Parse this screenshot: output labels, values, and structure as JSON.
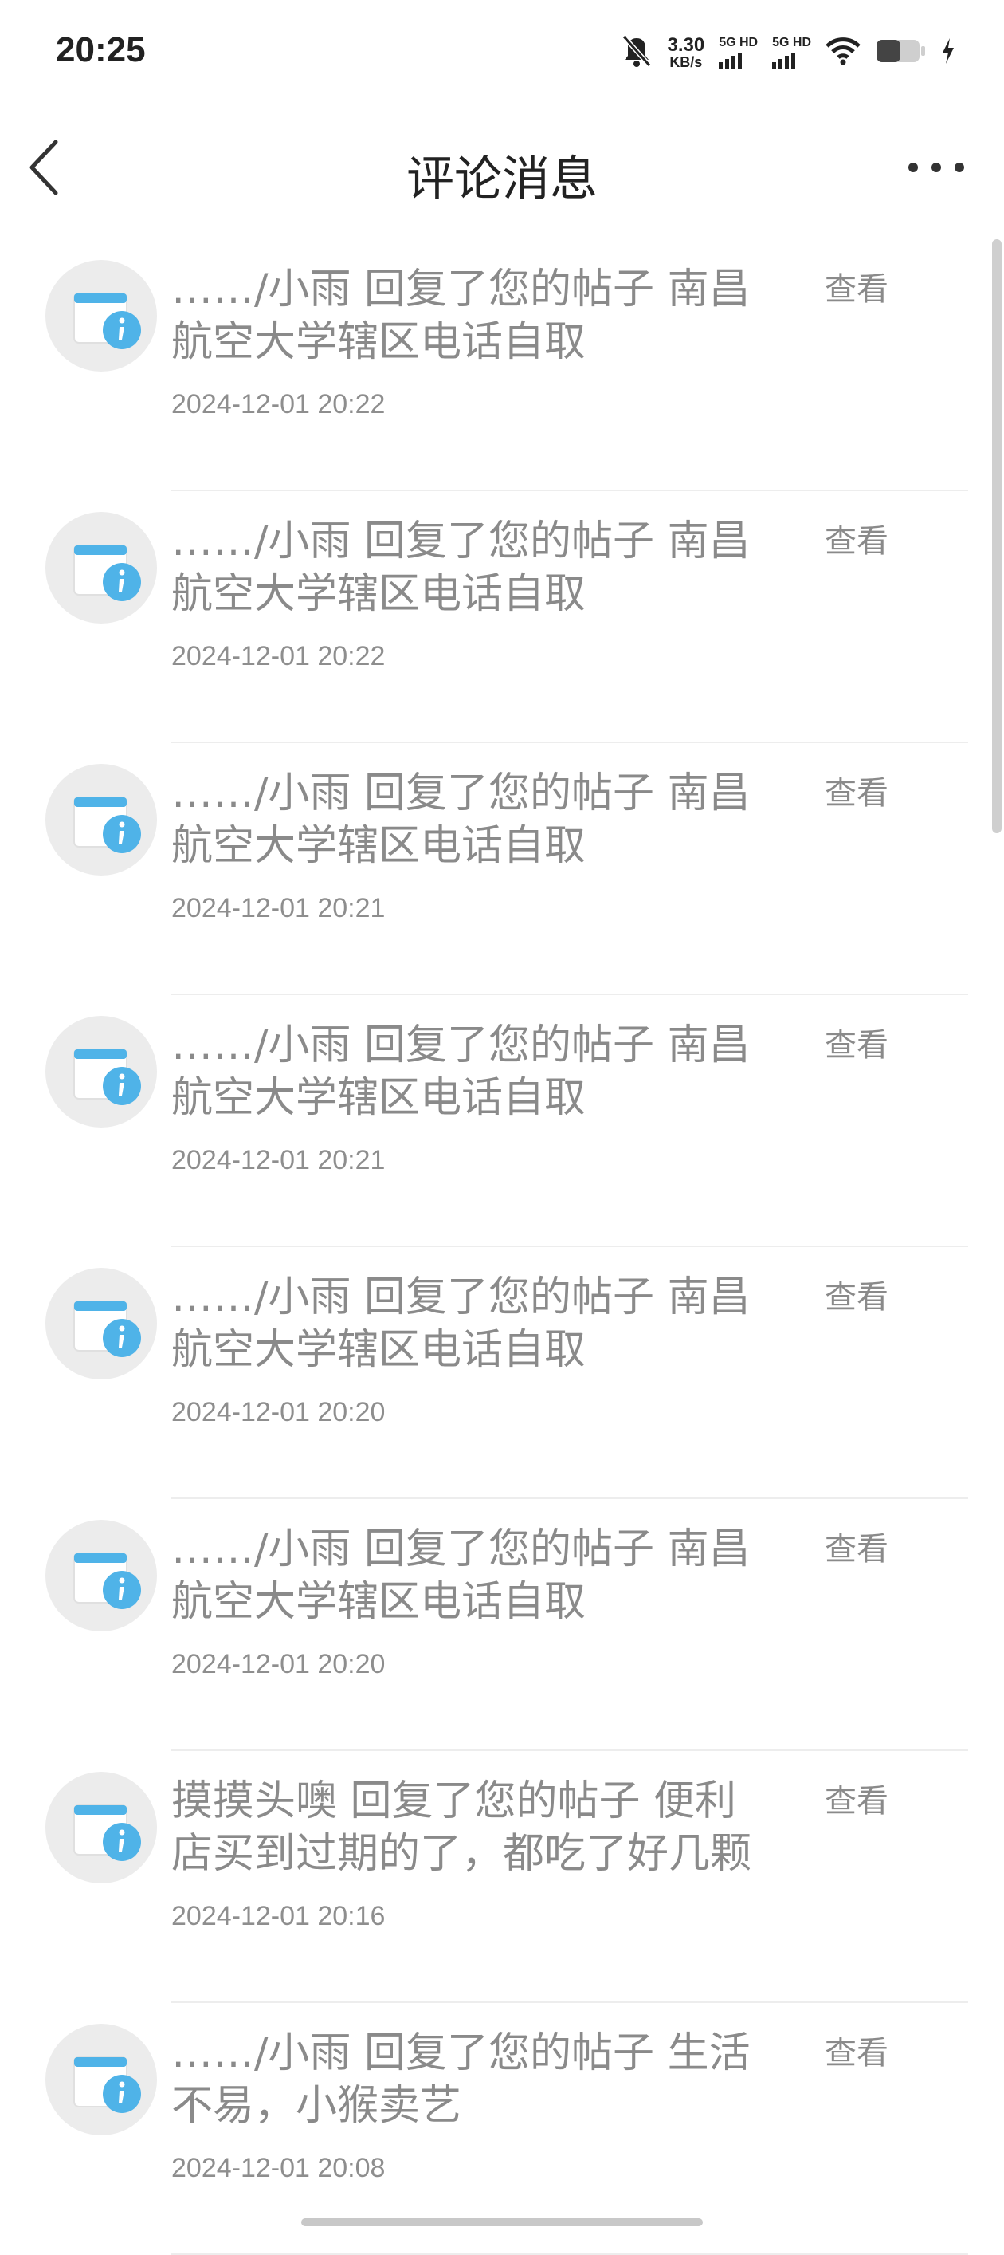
{
  "status_bar": {
    "time": "20:25",
    "net_speed_value": "3.30",
    "net_speed_unit": "KB/s",
    "sim1_label": "5G HD",
    "sim2_label": "5G HD",
    "icons": [
      "bell-muted-icon",
      "signal-icon",
      "wifi-icon",
      "battery-icon",
      "charging-icon"
    ]
  },
  "header": {
    "title": "评论消息",
    "back_icon": "chevron-left-icon",
    "more_icon": "more-icon"
  },
  "notifications": [
    {
      "message_line1": "……/小雨 回复了您的帖子 南昌",
      "message_line2": "航空大学辖区电话自取",
      "date": "2024-12-01 20:22",
      "action": "查看"
    },
    {
      "message_line1": "……/小雨 回复了您的帖子 南昌",
      "message_line2": "航空大学辖区电话自取",
      "date": "2024-12-01 20:22",
      "action": "查看"
    },
    {
      "message_line1": "……/小雨 回复了您的帖子 南昌",
      "message_line2": "航空大学辖区电话自取",
      "date": "2024-12-01 20:21",
      "action": "查看"
    },
    {
      "message_line1": "……/小雨 回复了您的帖子 南昌",
      "message_line2": "航空大学辖区电话自取",
      "date": "2024-12-01 20:21",
      "action": "查看"
    },
    {
      "message_line1": "……/小雨 回复了您的帖子 南昌",
      "message_line2": "航空大学辖区电话自取",
      "date": "2024-12-01 20:20",
      "action": "查看"
    },
    {
      "message_line1": "……/小雨 回复了您的帖子 南昌",
      "message_line2": "航空大学辖区电话自取",
      "date": "2024-12-01 20:20",
      "action": "查看"
    },
    {
      "message_line1": "摸摸头噢 回复了您的帖子 便利",
      "message_line2": "店买到过期的了，都吃了好几颗",
      "date": "2024-12-01 20:16",
      "action": "查看"
    },
    {
      "message_line1": "……/小雨 回复了您的帖子 生活",
      "message_line2": "不易，小猴卖艺",
      "date": "2024-12-01 20:08",
      "action": "查看"
    }
  ],
  "colors": {
    "icon_blue": "#4fb3e8",
    "text_gray": "#8a8a8a"
  }
}
